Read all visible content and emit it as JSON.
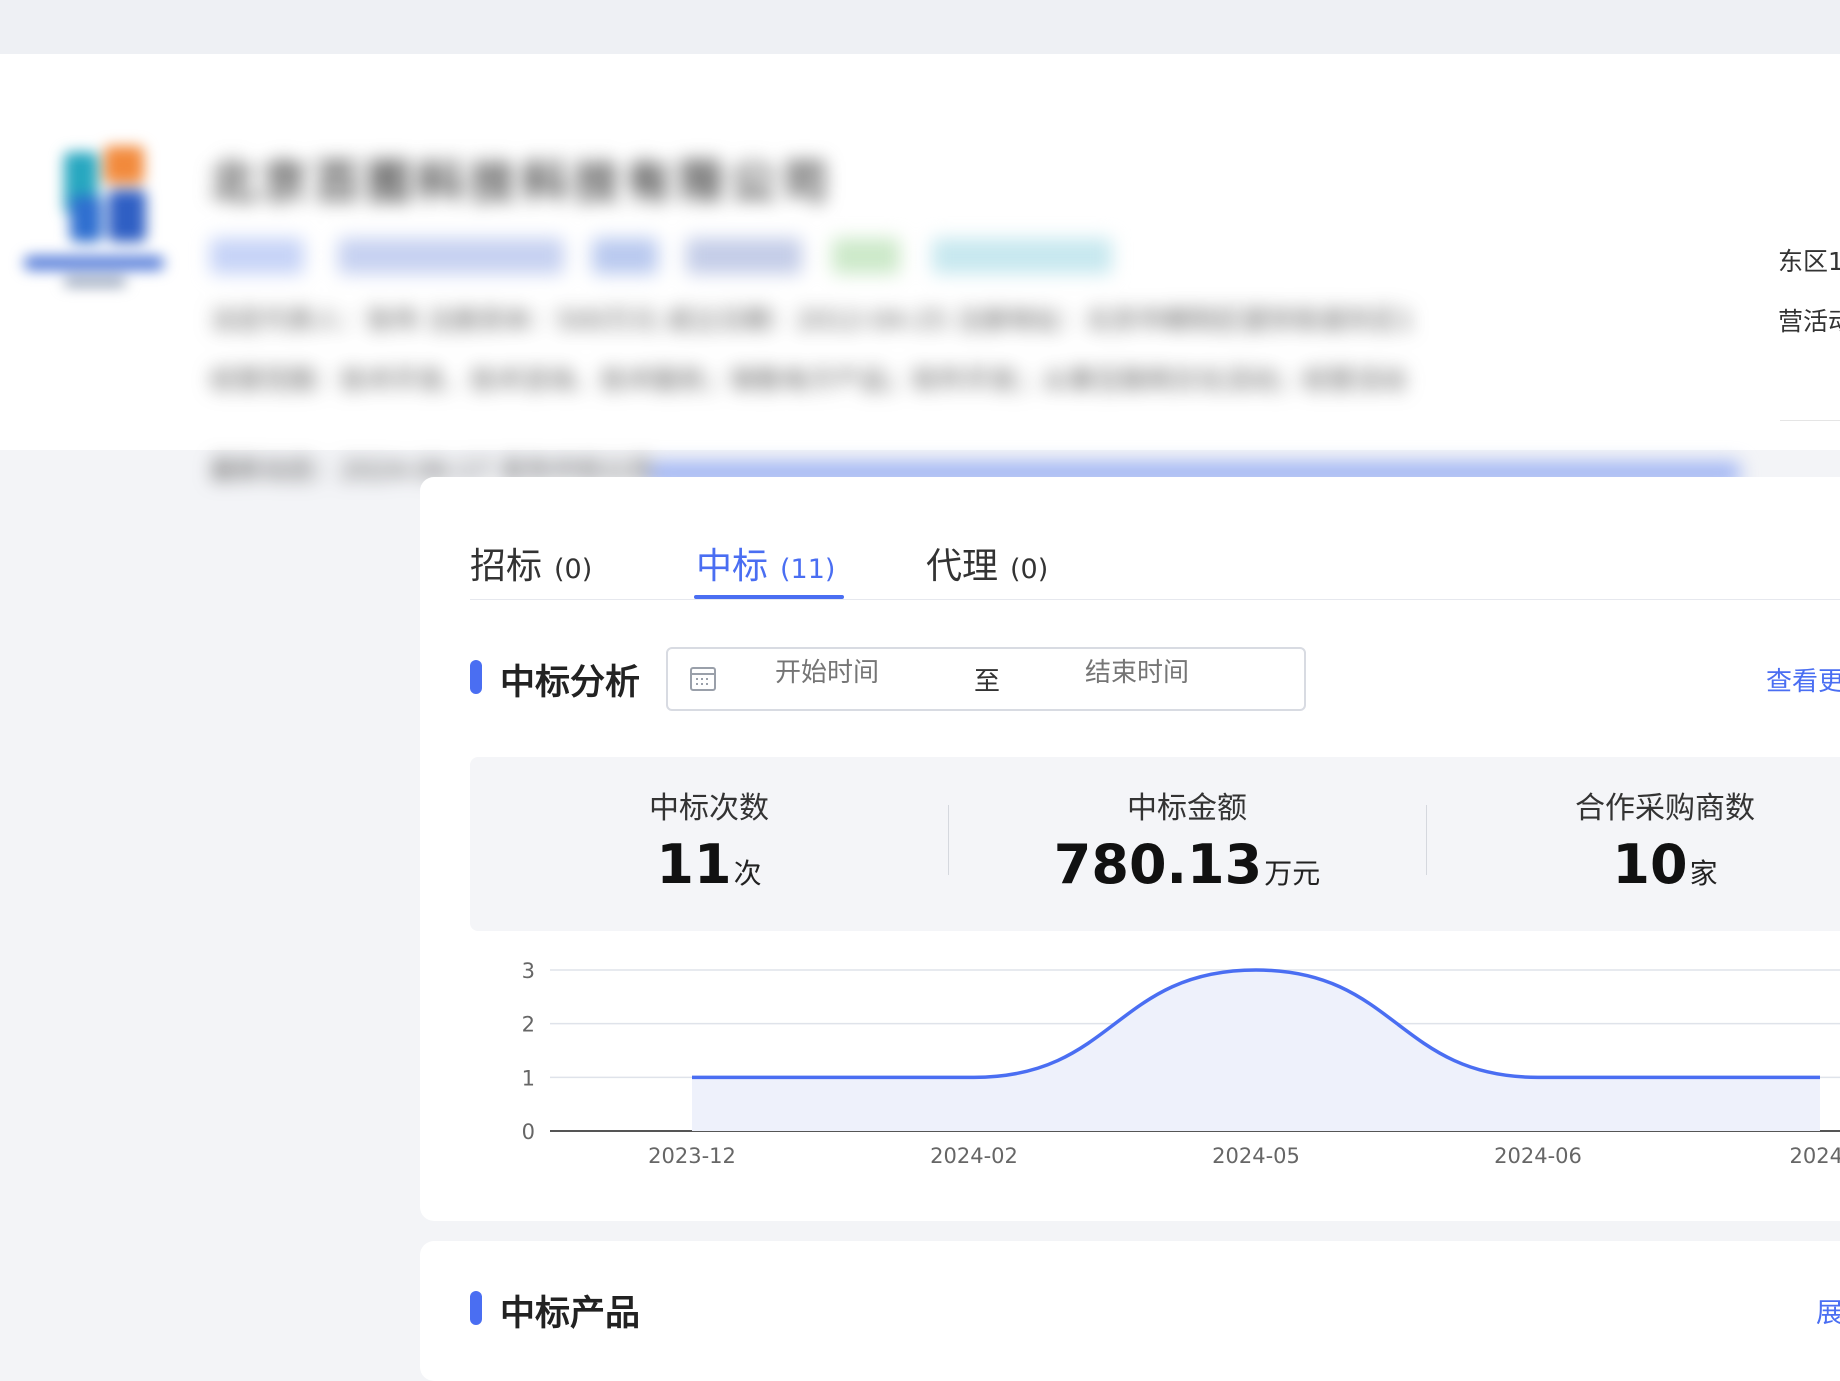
{
  "company": {
    "name": "北京百图科技科技有限公司",
    "tags": [
      {
        "text": "存续",
        "color": "#c6d3f7"
      },
      {
        "text": "高新技术企业",
        "color": "#c6d1f1"
      },
      {
        "text": "科技",
        "color": "#b9c9ef"
      },
      {
        "text": "小微企业",
        "color": "#c4cde8"
      },
      {
        "text": "中标",
        "color": "#cce9c9"
      },
      {
        "text": "科技型中小企业",
        "color": "#c7e8ef"
      }
    ],
    "info_line_1": "法定代表人：张伟   注册资本：500万元   成立日期：2012-04-25   注册地址：北京市朝阳区望京街道东区1",
    "info_line_2": "经营范围：技术开发、技术咨询、技术服务；销售电子产品；软件开发；从事互联网文化活动；经营活动",
    "info_line_3": "最新动态：2024-06-17 发布中标公告",
    "overflow_1": "东区1",
    "overflow_2": "营活动"
  },
  "tabs": [
    {
      "label": "招标",
      "count": "(0)"
    },
    {
      "label": "中标",
      "count": "(11)"
    },
    {
      "label": "代理",
      "count": "(0)"
    }
  ],
  "analysis": {
    "title": "中标分析",
    "start_placeholder": "开始时间",
    "separator": "至",
    "end_placeholder": "结束时间",
    "more_link": "查看更"
  },
  "stats": [
    {
      "label": "中标次数",
      "value": "11",
      "unit": "次"
    },
    {
      "label": "中标金额",
      "value": "780.13",
      "unit": "万元"
    },
    {
      "label": "合作采购商数",
      "value": "10",
      "unit": "家"
    }
  ],
  "colors": {
    "accent": "#4a6ef2",
    "area_fill": "#eef1fb"
  },
  "chart_data": {
    "type": "area",
    "x": [
      "2023-12",
      "2024-02",
      "2024-05",
      "2024-06",
      "2024-"
    ],
    "series": [
      {
        "values": [
          1,
          1,
          3,
          1,
          1
        ]
      }
    ],
    "yticks": [
      0,
      1,
      2,
      3
    ],
    "ylim": [
      0,
      3
    ],
    "grid": true,
    "smooth": true
  },
  "products": {
    "title": "中标产品",
    "expand_link": "展"
  }
}
